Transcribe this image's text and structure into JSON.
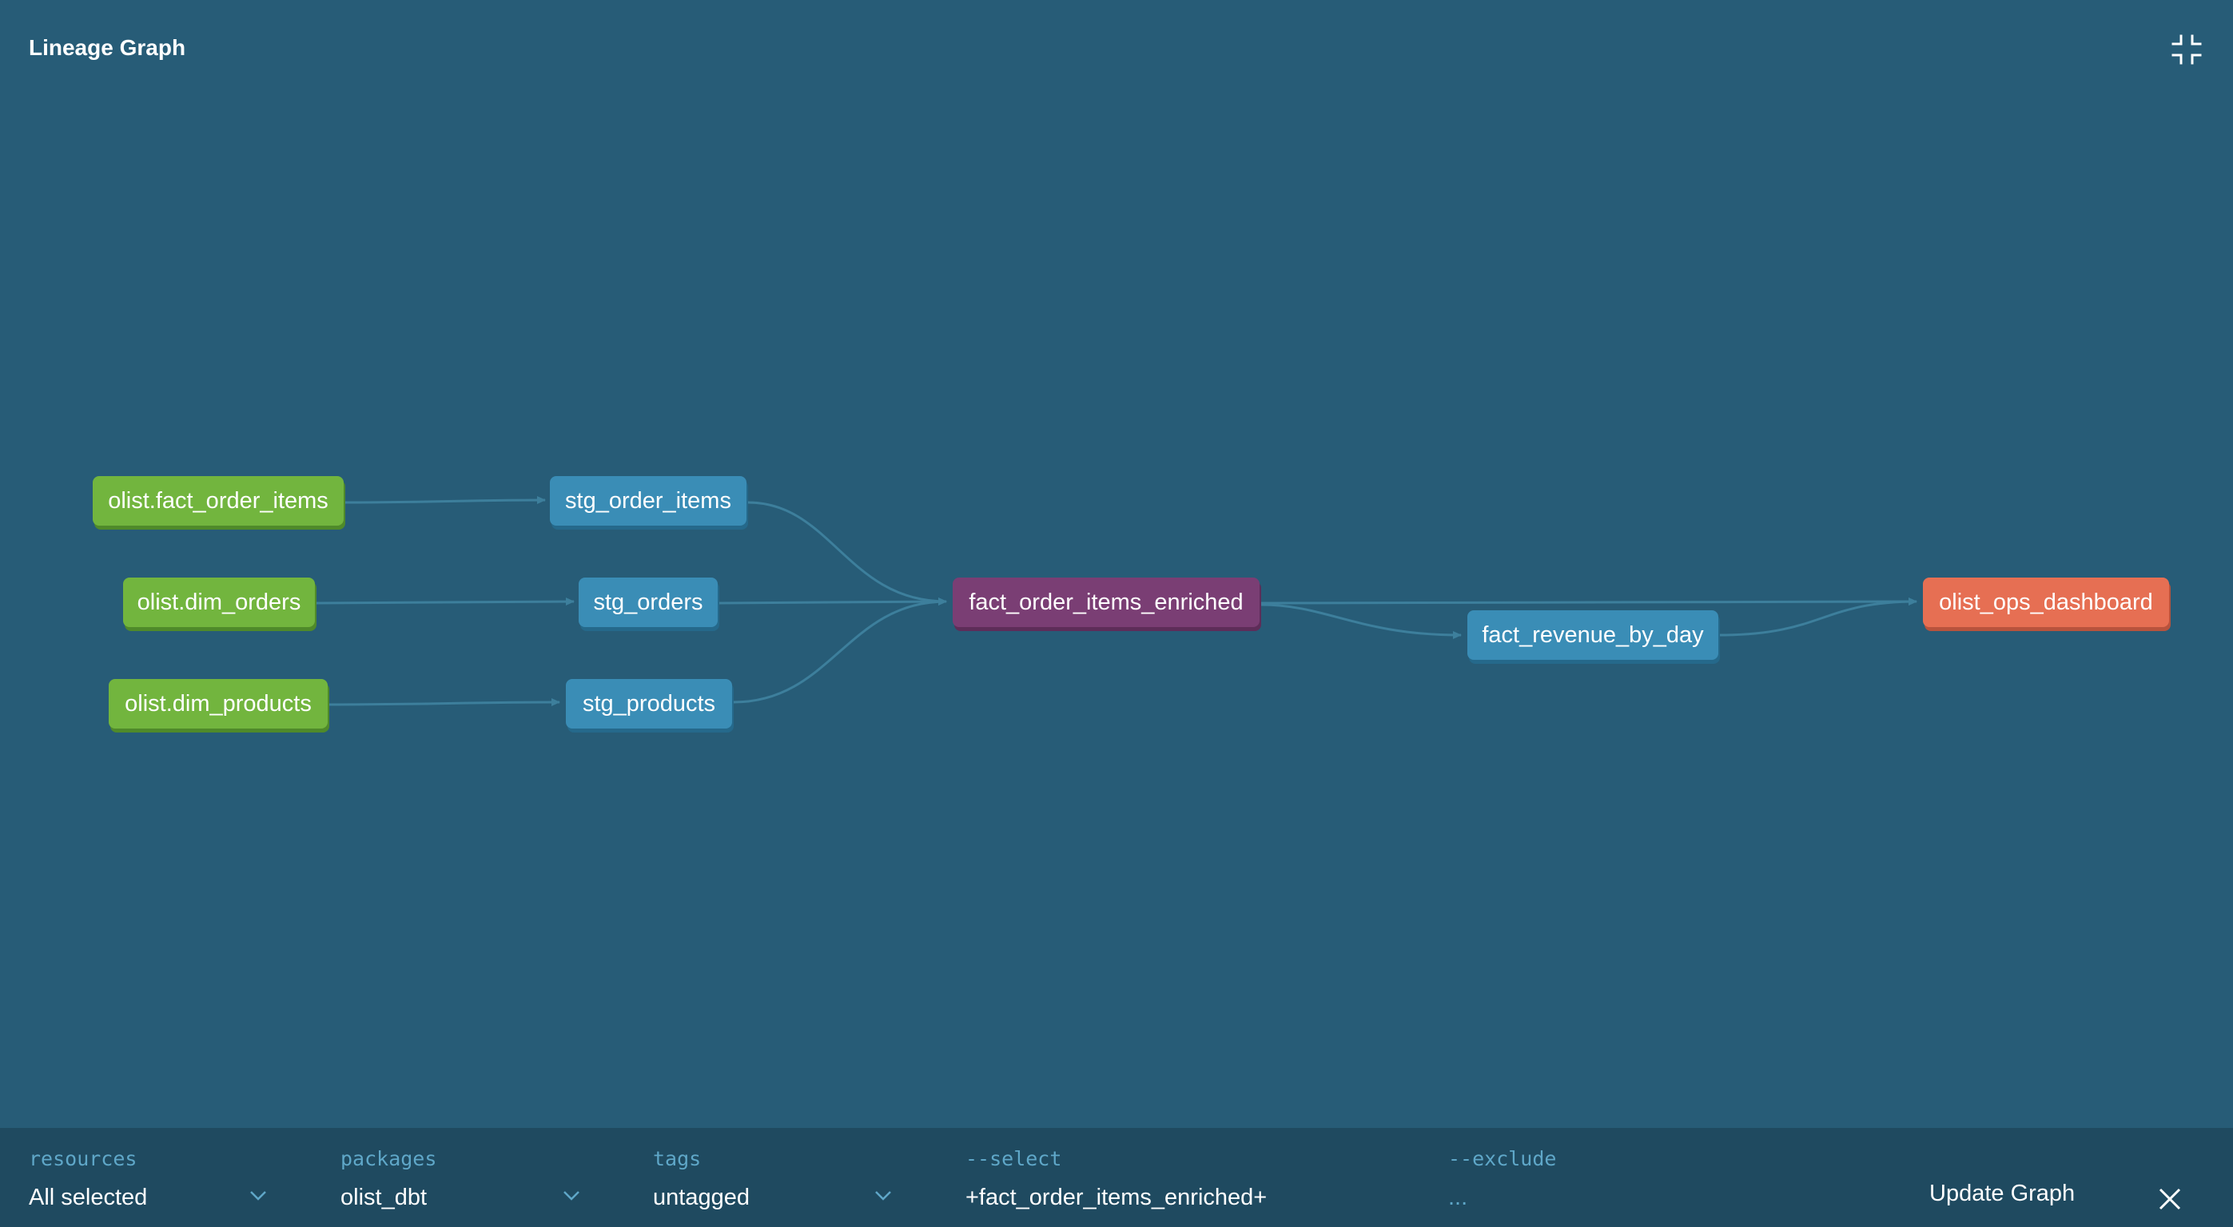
{
  "header": {
    "title": "Lineage Graph",
    "collapse_icon": "collapse-fullscreen-icon"
  },
  "graph": {
    "nodes": {
      "src_fact_order_items": "olist.fact_order_items",
      "src_dim_orders": "olist.dim_orders",
      "src_dim_products": "olist.dim_products",
      "stg_order_items": "stg_order_items",
      "stg_orders": "stg_orders",
      "stg_products": "stg_products",
      "fact_order_items_enriched": "fact_order_items_enriched",
      "fact_revenue_by_day": "fact_revenue_by_day",
      "olist_ops_dashboard": "olist_ops_dashboard"
    },
    "colors": {
      "background": "#275c77",
      "source": "#72b53e",
      "model": "#3a8db6",
      "selected": "#7a3e74",
      "exposure": "#e66f53",
      "edge": "#3d7f9c"
    }
  },
  "filters": {
    "resources": {
      "label": "resources",
      "value": "All selected"
    },
    "packages": {
      "label": "packages",
      "value": "olist_dbt"
    },
    "tags": {
      "label": "tags",
      "value": "untagged"
    },
    "select": {
      "label": "--select",
      "value": "+fact_order_items_enriched+"
    },
    "exclude": {
      "label": "--exclude",
      "value": "..."
    }
  },
  "actions": {
    "update_label": "Update Graph",
    "close_icon": "close-icon"
  }
}
